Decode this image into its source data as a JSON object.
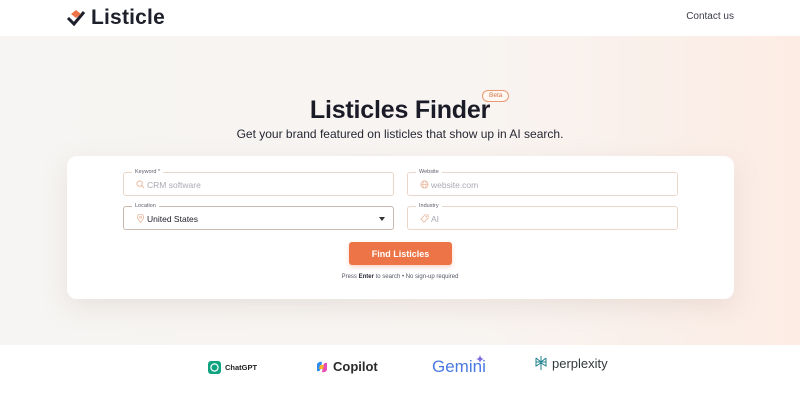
{
  "header": {
    "brand": "Listicle",
    "contact_label": "Contact us"
  },
  "hero": {
    "title": "Listicles Finder",
    "badge": "Beta",
    "subtitle": "Get your brand featured on listicles that show up in AI search."
  },
  "form": {
    "keyword": {
      "label": "Keyword *",
      "placeholder": "CRM software",
      "icon": "search-icon"
    },
    "website": {
      "label": "Website",
      "placeholder": "website.com",
      "icon": "globe-icon"
    },
    "location": {
      "label": "Location",
      "value": "United States",
      "icon": "pin-icon"
    },
    "industry": {
      "label": "Industry",
      "placeholder": "AI",
      "icon": "tag-icon"
    },
    "submit_label": "Find Listicles",
    "hint_pre": "Press ",
    "hint_key": "Enter",
    "hint_post": " to search • No sign-up required"
  },
  "partners": [
    {
      "name": "ChatGPT",
      "icon": "chatgpt-logo"
    },
    {
      "name": "Copilot",
      "icon": "copilot-logo"
    },
    {
      "name": "Gemini",
      "icon": "gemini-logo"
    },
    {
      "name": "perplexity",
      "icon": "perplexity-logo"
    }
  ],
  "colors": {
    "accent": "#ec7446",
    "text": "#1d1f2b"
  }
}
